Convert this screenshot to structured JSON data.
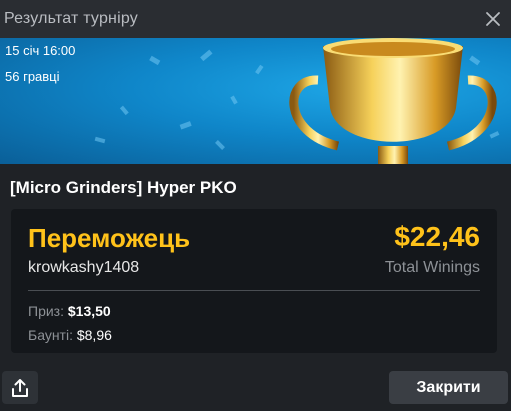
{
  "window": {
    "title": "Результат турніру"
  },
  "banner": {
    "date_time": "15 січ 16:00",
    "players": "56 гравці"
  },
  "tournament": {
    "name": "[Micro Grinders] Hyper PKO"
  },
  "result": {
    "winner_label": "Переможець",
    "player_name": "krowkashy1408",
    "total_amount": "$22,46",
    "total_label": "Total Winings",
    "prize_label": "Приз:",
    "prize_value": "$13,50",
    "bounty_label": "Баунті:",
    "bounty_value": "$8,96"
  },
  "footer": {
    "close_label": "Закрити"
  },
  "icons": {
    "close": "close-icon",
    "share": "share-icon",
    "trophy": "trophy-icon"
  },
  "colors": {
    "accent": "#ffc21a",
    "banner_blue": "#0f86c9"
  }
}
